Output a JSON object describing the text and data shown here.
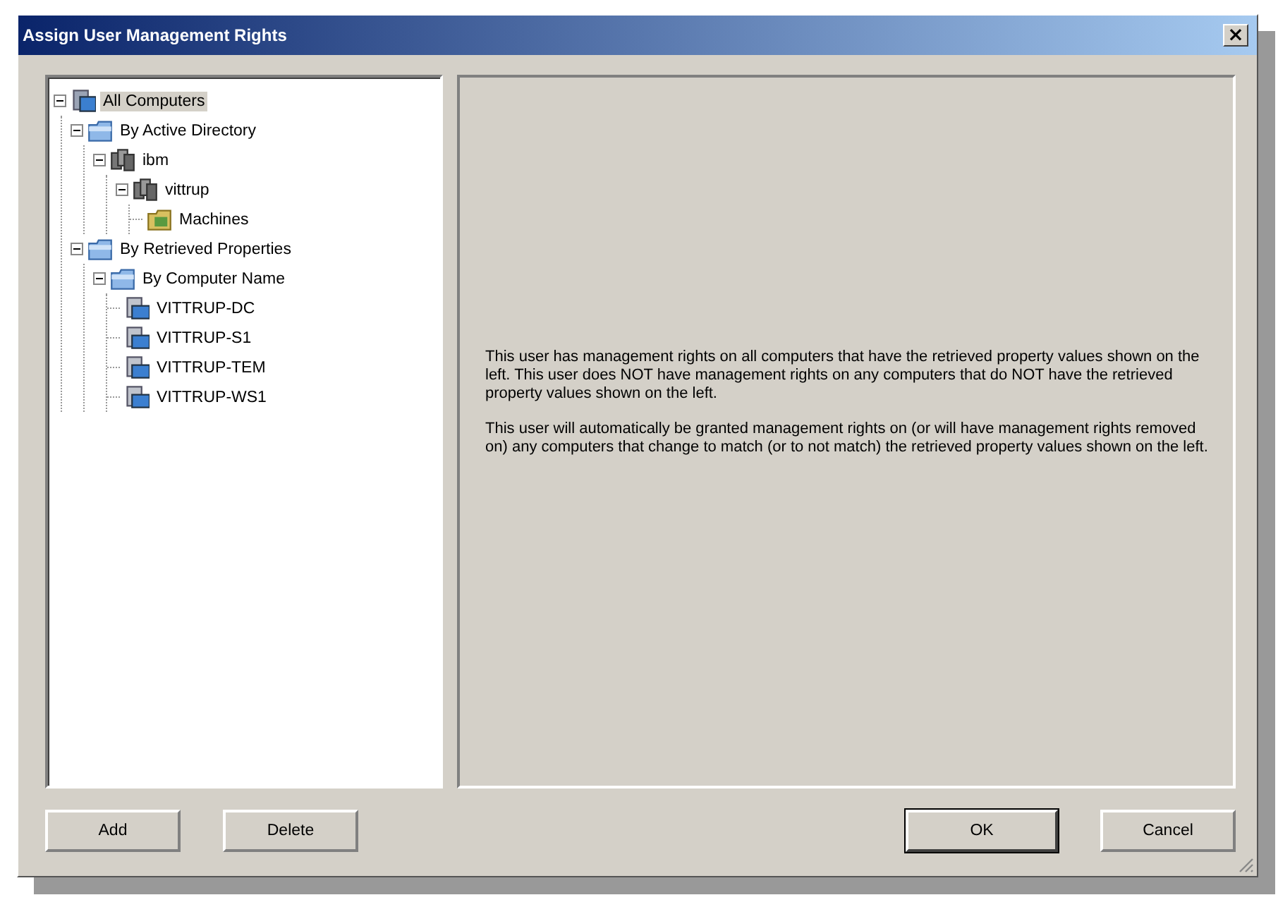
{
  "window": {
    "title": "Assign User Management Rights",
    "close": "×"
  },
  "tree": [
    {
      "label": "All Computers",
      "kind": "root",
      "selected": true,
      "expanded": true,
      "children": [
        {
          "label": "By Active Directory",
          "kind": "folder",
          "selected": false,
          "expanded": true,
          "children": [
            {
              "label": "ibm",
              "kind": "domain",
              "selected": false,
              "expanded": true,
              "children": [
                {
                  "label": "vittrup",
                  "kind": "domain",
                  "selected": false,
                  "expanded": true,
                  "children": [
                    {
                      "label": "Machines",
                      "kind": "unit",
                      "selected": false
                    }
                  ]
                }
              ]
            }
          ]
        },
        {
          "label": "By Retrieved Properties",
          "kind": "folder",
          "selected": false,
          "expanded": true,
          "children": [
            {
              "label": "By Computer Name",
              "kind": "folder",
              "selected": false,
              "expanded": true,
              "children": [
                {
                  "label": "VITTRUP-DC",
                  "kind": "computer",
                  "selected": false
                },
                {
                  "label": "VITTRUP-S1",
                  "kind": "computer",
                  "selected": false
                },
                {
                  "label": "VITTRUP-TEM",
                  "kind": "computer",
                  "selected": false
                },
                {
                  "label": "VITTRUP-WS1",
                  "kind": "computer",
                  "selected": false
                }
              ]
            }
          ]
        }
      ]
    }
  ],
  "description": [
    "This user has management rights on all computers that have the retrieved property values shown on the left. This user does NOT have management rights on any computers that do NOT have the retrieved property values shown on the left.",
    "This user will automatically be granted management rights on (or will have management rights removed on) any computers that change to match (or to not match) the retrieved property values shown on the left."
  ],
  "left_buttons": [
    {
      "label": "Add",
      "default": false
    },
    {
      "label": "Delete",
      "default": false
    }
  ],
  "right_buttons": [
    {
      "label": "OK",
      "default": true
    },
    {
      "label": "Cancel",
      "default": false
    }
  ]
}
